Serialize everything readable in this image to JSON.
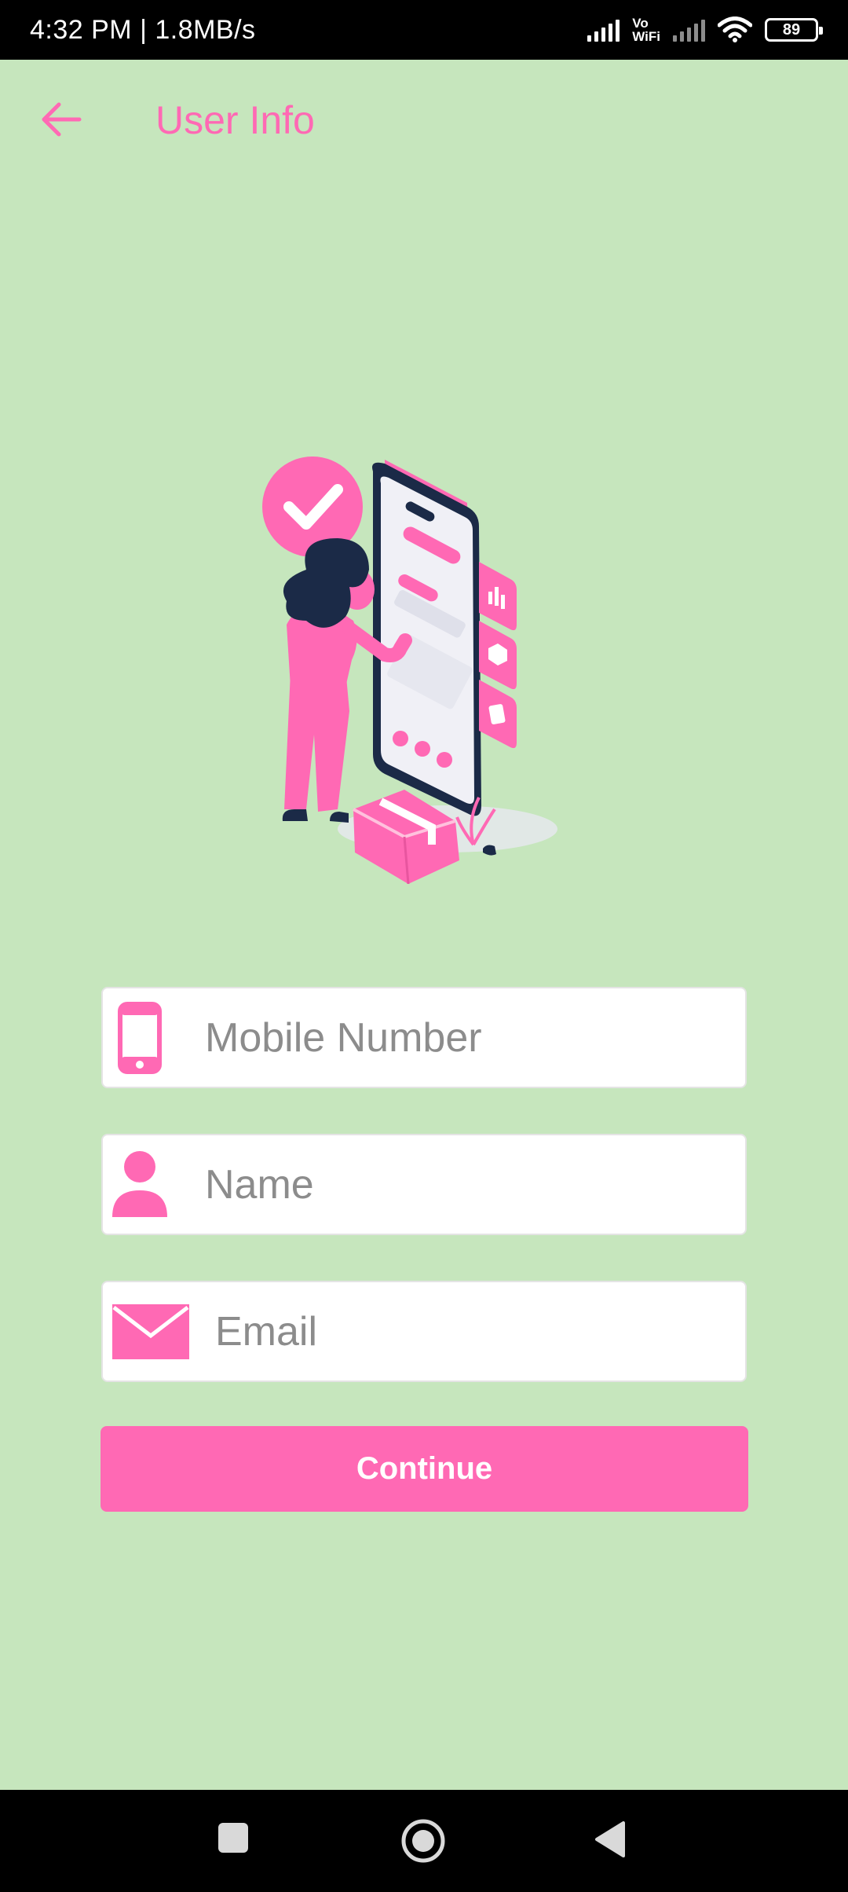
{
  "status_bar": {
    "time_speed": "4:32 PM | 1.8MB/s",
    "vowifi_top": "Vo",
    "vowifi_bottom": "WiFi",
    "battery": "89"
  },
  "header": {
    "back_icon": "arrow-left-icon",
    "title": "User Info"
  },
  "illustration": {
    "description_icon": "woman-with-phone-illustration"
  },
  "form": {
    "mobile": {
      "icon": "phone-icon",
      "placeholder": "Mobile Number",
      "value": ""
    },
    "name": {
      "icon": "person-icon",
      "placeholder": "Name",
      "value": ""
    },
    "email": {
      "icon": "envelope-icon",
      "placeholder": "Email",
      "value": ""
    },
    "continue_label": "Continue"
  },
  "colors": {
    "accent": "#ff69b4",
    "background": "#c6e6bd",
    "field_bg": "#ffffff",
    "dark": "#1b2a47"
  },
  "nav_bar": {
    "recents_icon": "square-icon",
    "home_icon": "circle-home-icon",
    "back_icon": "triangle-back-icon"
  }
}
